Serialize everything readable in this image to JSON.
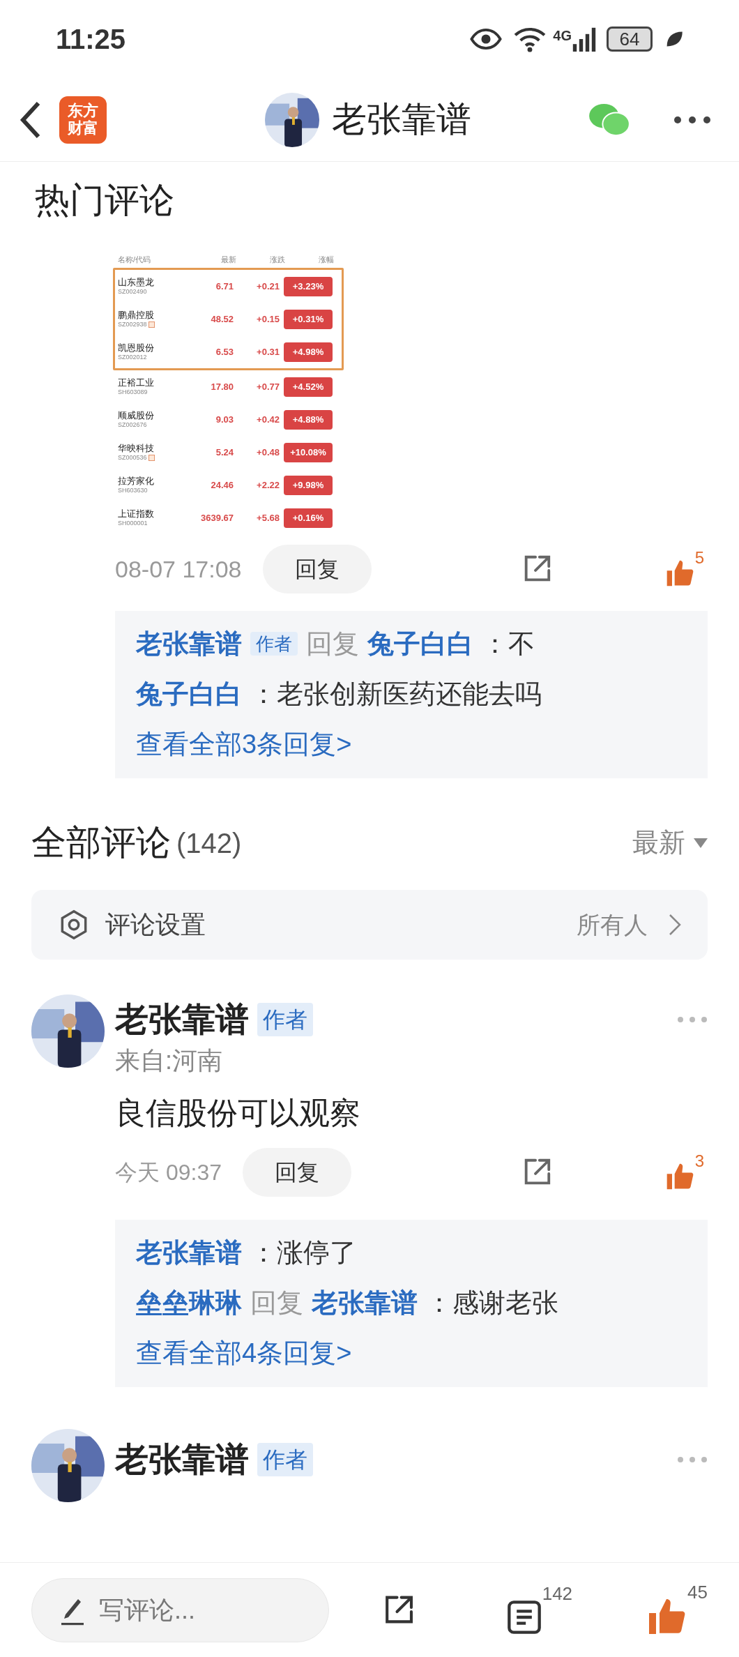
{
  "status_bar": {
    "time": "11:25",
    "network": "4G",
    "battery": "64"
  },
  "nav": {
    "logo": [
      "东方",
      "财富"
    ],
    "title": "老张靠谱"
  },
  "hot": {
    "heading": "热门评论",
    "stock_shot": {
      "columns": [
        "名称/代码",
        "最新",
        "涨跌",
        "涨幅"
      ],
      "rows": [
        {
          "name": "山东墨龙",
          "code": "SZ002490",
          "price": "6.71",
          "change": "+0.21",
          "pct": "+3.23%",
          "margin": false,
          "highlighted": true
        },
        {
          "name": "鹏鼎控股",
          "code": "SZ002938",
          "price": "48.52",
          "change": "+0.15",
          "pct": "+0.31%",
          "margin": true,
          "highlighted": true
        },
        {
          "name": "凯恩股份",
          "code": "SZ002012",
          "price": "6.53",
          "change": "+0.31",
          "pct": "+4.98%",
          "margin": false,
          "highlighted": true
        },
        {
          "name": "正裕工业",
          "code": "SH603089",
          "price": "17.80",
          "change": "+0.77",
          "pct": "+4.52%",
          "margin": false,
          "highlighted": false
        },
        {
          "name": "顺威股份",
          "code": "SZ002676",
          "price": "9.03",
          "change": "+0.42",
          "pct": "+4.88%",
          "margin": false,
          "highlighted": false
        },
        {
          "name": "华映科技",
          "code": "SZ000536",
          "price": "5.24",
          "change": "+0.48",
          "pct": "+10.08%",
          "margin": true,
          "highlighted": false
        },
        {
          "name": "拉芳家化",
          "code": "SH603630",
          "price": "24.46",
          "change": "+2.22",
          "pct": "+9.98%",
          "margin": false,
          "highlighted": false
        },
        {
          "name": "上证指数",
          "code": "SH000001",
          "price": "3639.67",
          "change": "+5.68",
          "pct": "+0.16%",
          "margin": false,
          "highlighted": false
        }
      ]
    },
    "time": "08-07 17:08",
    "reply_button": "回复",
    "likes": "5",
    "replies": [
      {
        "author": "老张靠谱",
        "author_badge": "作者",
        "verb": "回复",
        "target": "兔子白白",
        "text": "：不"
      },
      {
        "author": "兔子白白",
        "text": "：老张创新医药还能去吗"
      }
    ],
    "more": "查看全部3条回复>"
  },
  "all": {
    "heading": "全部评论",
    "count": "(142)",
    "sort": "最新",
    "settings": {
      "label": "评论设置",
      "value": "所有人"
    },
    "comments": [
      {
        "author": "老张靠谱",
        "badge": "作者",
        "location": "来自:河南",
        "text": "良信股份可以观察",
        "time": "今天 09:37",
        "reply_button": "回复",
        "likes": "3",
        "replies": [
          {
            "author": "老张靠谱",
            "text": "：涨停了"
          },
          {
            "author": "垒垒琳琳",
            "verb": "回复",
            "target": "老张靠谱",
            "text": "：感谢老张"
          }
        ],
        "more": "查看全部4条回复>"
      },
      {
        "author": "老张靠谱",
        "badge": "作者"
      }
    ]
  },
  "bottom_bar": {
    "placeholder": "写评论...",
    "comments_count": "142",
    "likes_count": "45"
  }
}
